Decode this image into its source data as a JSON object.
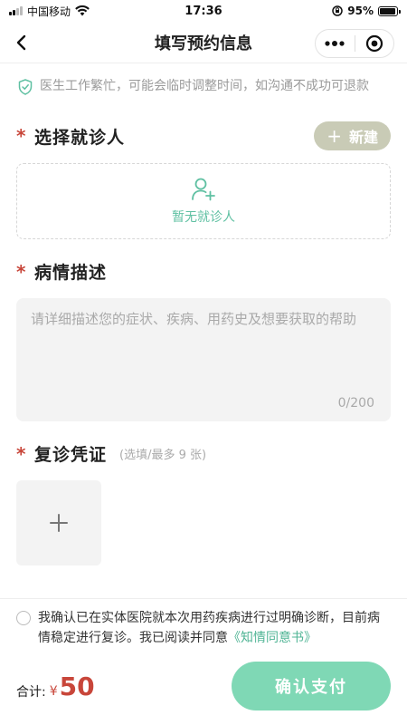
{
  "status_bar": {
    "carrier": "中国移动",
    "time": "17:36",
    "battery": "95%",
    "battery_level": 0.95
  },
  "nav": {
    "title": "填写预约信息",
    "back_icon": "chevron-left-icon",
    "more_icon": "more-dots-icon",
    "target_icon": "target-icon"
  },
  "notice": {
    "icon": "shield-check-icon",
    "text": "医生工作繁忙，可能会临时调整时间，如沟通不成功可退款"
  },
  "patient": {
    "required_mark": "*",
    "title": "选择就诊人",
    "new_button": {
      "icon": "+",
      "label": "新建"
    },
    "empty_icon": "add-user-icon",
    "empty_text": "暂无就诊人"
  },
  "description": {
    "required_mark": "*",
    "title": "病情描述",
    "placeholder": "请详细描述您的症状、疾病、用药史及想要获取的帮助",
    "counter": "0/200"
  },
  "voucher": {
    "required_mark": "*",
    "title": "复诊凭证",
    "hint": "(选填/最多 9 张)",
    "upload_icon": "plus-icon"
  },
  "consent": {
    "text": "我确认已在实体医院就本次用药疾病进行过明确诊断，目前病情稳定进行复诊。我已阅读并同意",
    "link": "《知情同意书》"
  },
  "footer": {
    "total_label": "合计:",
    "currency": "¥",
    "amount": "50",
    "pay_button": "确认支付"
  },
  "colors": {
    "accent": "#7fd8b5",
    "accent_text": "#4fb494",
    "required": "#c8463a",
    "new_button_bg": "#c9cbb6"
  }
}
